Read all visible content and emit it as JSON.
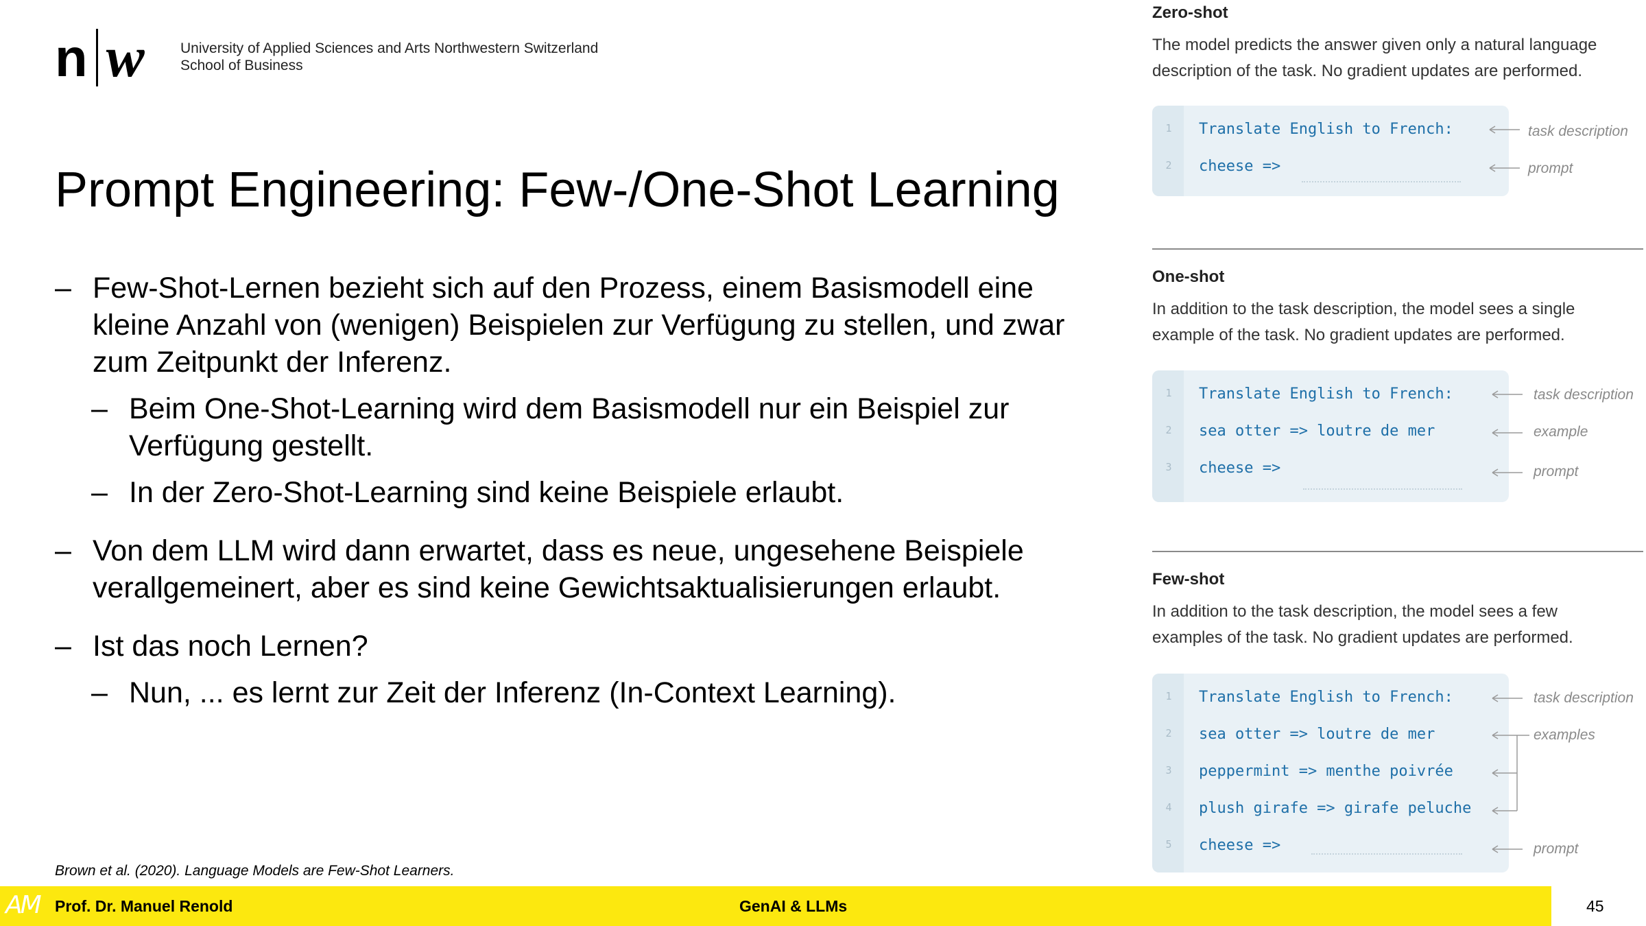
{
  "header": {
    "logo_n": "n",
    "logo_w": "w",
    "org_line1": "University of Applied Sciences and Arts Northwestern Switzerland",
    "org_line2": "School of Business"
  },
  "title": "Prompt Engineering: Few-/One-Shot Learning",
  "bullets": [
    {
      "level": 1,
      "dash": "–",
      "line1": "Few-Shot-Lernen bezieht sich auf den Prozess, einem Basismodell eine",
      "line2": "kleine Anzahl von (wenigen) Beispielen zur Verfügung zu stellen, und zwar",
      "line3": "zum Zeitpunkt der Inferenz."
    },
    {
      "level": 2,
      "dash": "–",
      "line1": "Beim One-Shot-Learning wird dem Basismodell nur ein Beispiel zur",
      "line2": "Verfügung gestellt."
    },
    {
      "level": 2,
      "dash": "–",
      "line1": "In der Zero-Shot-Learning sind keine Beispiele erlaubt."
    },
    {
      "level": 1,
      "dash": "–",
      "line1": "Von dem LLM wird dann erwartet, dass es neue, ungesehene Beispiele",
      "line2": "verallgemeinert, aber es sind keine Gewichtsaktualisierungen erlaubt."
    },
    {
      "level": 1,
      "dash": "–",
      "line1": "Ist das noch Lernen?"
    },
    {
      "level": 2,
      "dash": "–",
      "line1": "Nun, ... es lernt zur Zeit der Inferenz (In-Context Learning)."
    }
  ],
  "reference": "Brown et al. (2020). Language Models are Few-Shot Learners.",
  "footer": {
    "logo": "AM",
    "author": "Prof. Dr. Manuel Renold",
    "course": "GenAI & LLMs",
    "page": "45"
  },
  "figure": {
    "zero_shot": {
      "title": "Zero-shot",
      "desc1": "The model predicts the answer given only a natural language",
      "desc2": "description of the task. No gradient updates are performed.",
      "lines": [
        {
          "n": "1",
          "code": "Translate English to French:",
          "note": "task description"
        },
        {
          "n": "2",
          "code": "cheese =>",
          "note": "prompt"
        }
      ]
    },
    "one_shot": {
      "title": "One-shot",
      "desc1": "In addition to the task description, the model sees a single",
      "desc2": "example of the task. No gradient updates are performed.",
      "lines": [
        {
          "n": "1",
          "code": "Translate English to French:",
          "note": "task description"
        },
        {
          "n": "2",
          "code": "sea otter => loutre de mer",
          "note": "example"
        },
        {
          "n": "3",
          "code": "cheese =>",
          "note": "prompt"
        }
      ]
    },
    "few_shot": {
      "title": "Few-shot",
      "desc1": "In addition to the task description, the model sees a few",
      "desc2": "examples of the task. No gradient updates are performed.",
      "lines": [
        {
          "n": "1",
          "code": "Translate English to French:",
          "note": "task description"
        },
        {
          "n": "2",
          "code": "sea otter => loutre de mer",
          "note": "examples"
        },
        {
          "n": "3",
          "code": "peppermint => menthe poivrée",
          "note": ""
        },
        {
          "n": "4",
          "code": "plush girafe => girafe peluche",
          "note": ""
        },
        {
          "n": "5",
          "code": "cheese =>",
          "note": "prompt"
        }
      ]
    }
  },
  "colors": {
    "footer_bar": "#fce80f",
    "code_text": "#1e6fa8",
    "code_bg": "#e9f1f6",
    "annotation": "#8a8a8a"
  }
}
